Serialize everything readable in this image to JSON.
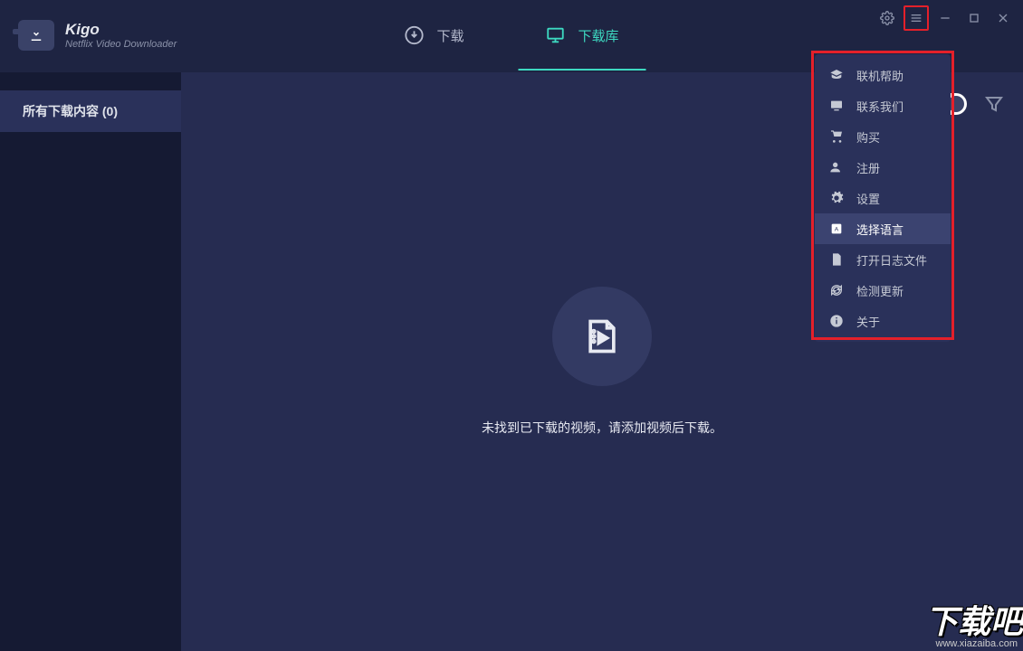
{
  "app": {
    "name": "Kigo",
    "subtitle": "Netflix Video Downloader"
  },
  "tabs": {
    "download": "下载",
    "library": "下载库"
  },
  "sidebar": {
    "all_downloads": "所有下载内容 (0)"
  },
  "empty": {
    "message": "未找到已下载的视频，请添加视频后下载。"
  },
  "menu": {
    "online_help": "联机帮助",
    "contact_us": "联系我们",
    "purchase": "购买",
    "register": "注册",
    "settings": "设置",
    "language": "选择语言",
    "open_log": "打开日志文件",
    "check_updates": "检测更新",
    "about": "关于"
  },
  "watermark": {
    "main": "下载吧",
    "url": "www.xiazaiba.com"
  }
}
